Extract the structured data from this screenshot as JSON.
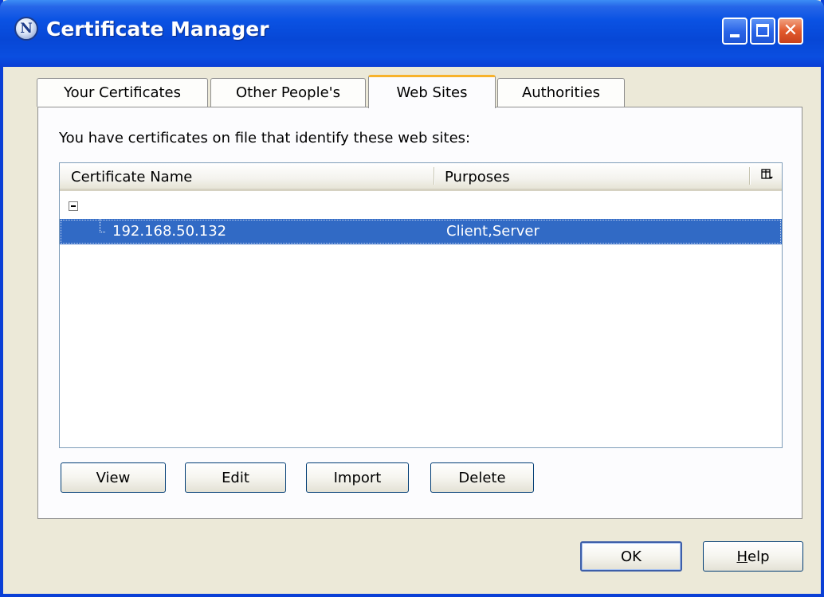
{
  "window": {
    "title": "Certificate Manager",
    "app_icon_letter": "N",
    "controls": {
      "minimize": "minimize",
      "maximize": "maximize",
      "close": "✕"
    }
  },
  "tabs": [
    {
      "label": "Your Certificates",
      "active": false
    },
    {
      "label": "Other People's",
      "active": false
    },
    {
      "label": "Web Sites",
      "active": true
    },
    {
      "label": "Authorities",
      "active": false
    }
  ],
  "panel": {
    "intro": "You have certificates on file that identify these web sites:",
    "columns": [
      "Certificate Name",
      "Purposes"
    ],
    "rows": [
      {
        "name": "192.168.50.132",
        "purposes": "Client,Server",
        "selected": true
      }
    ],
    "actions": {
      "view": "View",
      "edit": "Edit",
      "import": "Import",
      "delete": "Delete"
    }
  },
  "dialog_buttons": {
    "ok": "OK",
    "help_prefix": "",
    "help_mnemonic": "H",
    "help_rest": "elp"
  },
  "colors": {
    "title_bar": "#0a52e3",
    "selection": "#316ac5",
    "active_tab_accent": "#f7b22c",
    "face": "#ece9d8"
  }
}
